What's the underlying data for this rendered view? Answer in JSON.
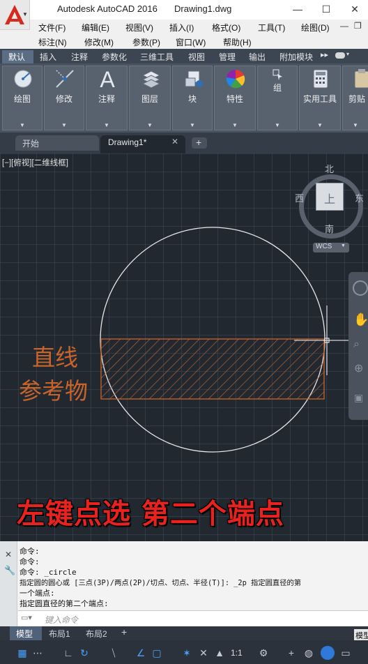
{
  "window": {
    "app_title": "Autodesk AutoCAD 2016",
    "file_title": "Drawing1.dwg",
    "minimize": "—",
    "maximize": "☐",
    "close": "✕"
  },
  "menubar": {
    "row1": [
      "文件(F)",
      "编辑(E)",
      "视图(V)",
      "插入(I)",
      "格式(O)",
      "工具(T)",
      "绘图(D)"
    ],
    "row2": [
      "标注(N)",
      "修改(M)",
      "参数(P)",
      "窗口(W)",
      "帮助(H)"
    ]
  },
  "ribbon_tabs": [
    "默认",
    "插入",
    "注释",
    "参数化",
    "三维工具",
    "视图",
    "管理",
    "输出",
    "附加模块"
  ],
  "ribbon_panels": [
    "绘图",
    "修改",
    "注释",
    "图层",
    "块",
    "特性",
    "组",
    "实用工具",
    "剪贴"
  ],
  "doc_tabs": {
    "start": "开始",
    "drawing": "Drawing1*",
    "add": "+"
  },
  "viewport": {
    "label": "[−][俯视][二维线框]",
    "viewcube": {
      "north": "北",
      "south": "南",
      "east": "东",
      "west": "西",
      "top": "上",
      "wcs": "WCS"
    }
  },
  "annotation": {
    "ref_line1": "直线",
    "ref_line2": "参考物",
    "instruction": "左键点选 第二个端点",
    "color_orange": "#c8642a",
    "color_red": "#e8231f"
  },
  "command": {
    "history": [
      "命令:",
      "命令:",
      "命令: _circle",
      "指定圆的圆心或 [三点(3P)/两点(2P)/切点、切点、半径(T)]: _2p 指定圆直径的第",
      "一个端点:",
      "指定圆直径的第二个端点:"
    ],
    "placeholder": "键入命令"
  },
  "layout_tabs": [
    "模型",
    "布局1",
    "布局2"
  ],
  "statusbar": {
    "scale": "1:1",
    "model_label": "模型"
  }
}
